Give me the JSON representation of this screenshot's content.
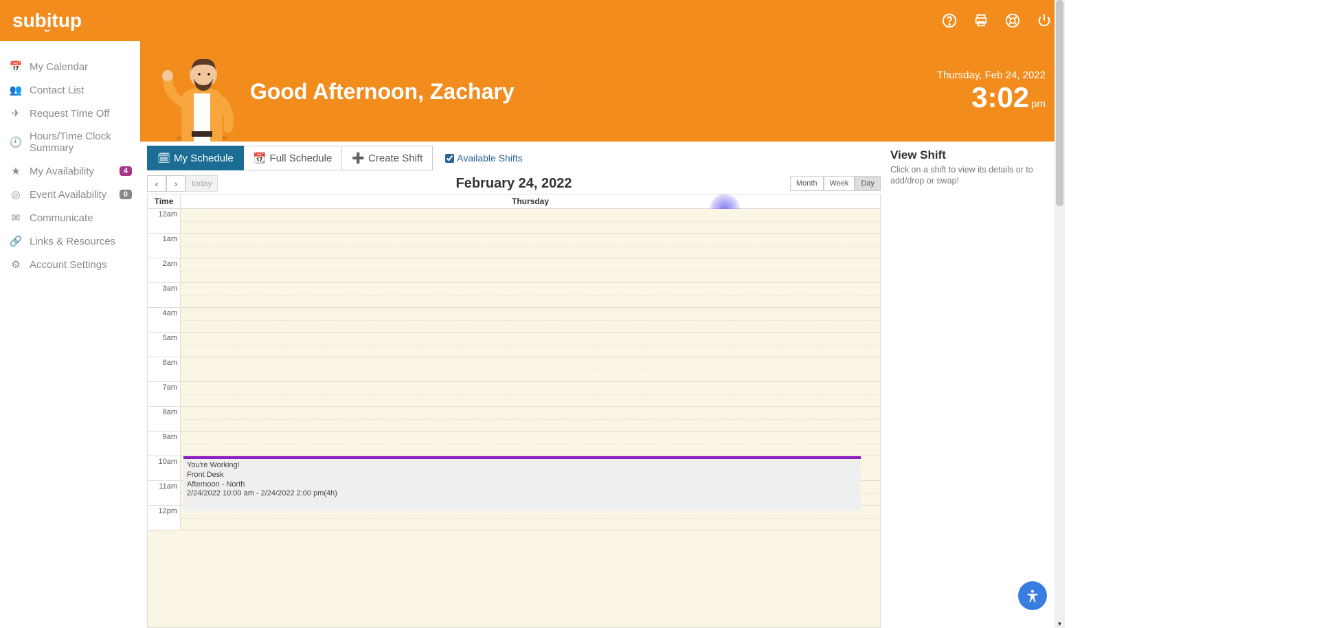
{
  "brand": "subitup",
  "sidebar": {
    "items": [
      {
        "label": "My Calendar",
        "icon": "calendar"
      },
      {
        "label": "Contact List",
        "icon": "users"
      },
      {
        "label": "Request Time Off",
        "icon": "plane"
      },
      {
        "label": "Hours/Time Clock Summary",
        "icon": "clock"
      },
      {
        "label": "My Availability",
        "icon": "star",
        "badge": "4"
      },
      {
        "label": "Event Availability",
        "icon": "target",
        "badge": "0"
      },
      {
        "label": "Communicate",
        "icon": "mail"
      },
      {
        "label": "Links & Resources",
        "icon": "link"
      },
      {
        "label": "Account Settings",
        "icon": "gear"
      }
    ]
  },
  "hero": {
    "greeting": "Good Afternoon, Zachary",
    "date": "Thursday, Feb 24, 2022",
    "time": "3:02",
    "ampm": "pm"
  },
  "tabs": {
    "my_schedule": "My Schedule",
    "full_schedule": "Full Schedule",
    "create_shift": "Create Shift",
    "available_shifts": "Available Shifts"
  },
  "calendar": {
    "title": "February 24, 2022",
    "today_label": "today",
    "month": "Month",
    "week": "Week",
    "day": "Day",
    "time_header": "Time",
    "day_header": "Thursday",
    "hours": [
      "12am",
      "1am",
      "2am",
      "3am",
      "4am",
      "5am",
      "6am",
      "7am",
      "8am",
      "9am",
      "10am",
      "11am",
      "12pm"
    ]
  },
  "shift": {
    "line1": "You're Working!",
    "line2": "Front Desk",
    "line3": "Afternoon - North",
    "line4": "2/24/2022 10:00 am - 2/24/2022 2:00 pm(4h)"
  },
  "viewshift": {
    "title": "View Shift",
    "body": "Click on a shift to view its details or to add/drop or swap!"
  }
}
